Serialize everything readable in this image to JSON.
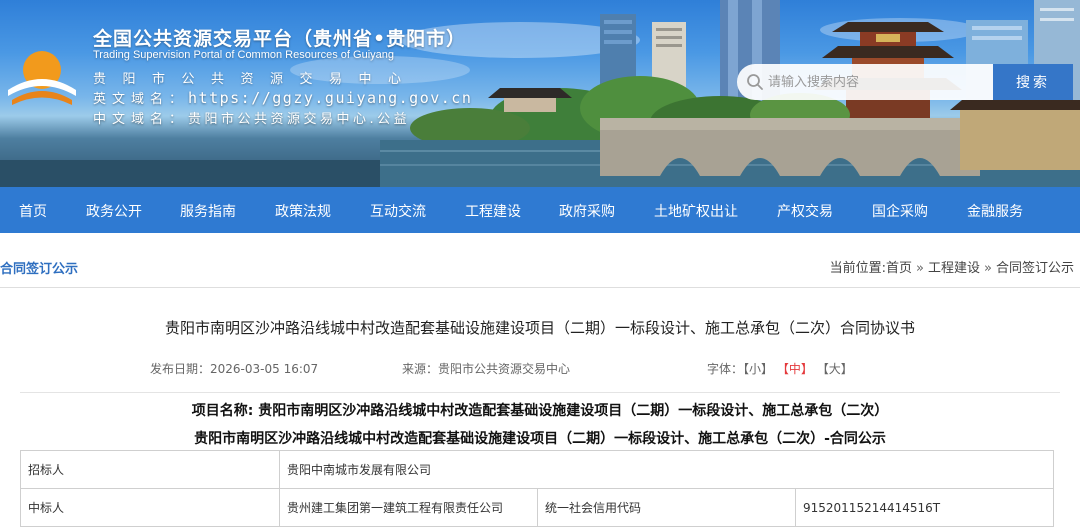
{
  "header": {
    "title": "全国公共资源交易平台（贵州省•贵阳市）",
    "subtitle": "Trading Supervision Portal of Common Resources of Guiyang",
    "org": "贵阳市公共资源交易中心",
    "en_domain_label": "英文域名：",
    "en_domain": "https://ggzy.guiyang.gov.cn",
    "cn_domain_label": "中文域名：",
    "cn_domain": "贵阳市公共资源交易中心.公益"
  },
  "search": {
    "placeholder": "请输入搜索内容",
    "button_label": "搜索"
  },
  "nav": {
    "items": [
      "首页",
      "政务公开",
      "服务指南",
      "政策法规",
      "互动交流",
      "工程建设",
      "政府采购",
      "土地矿权出让",
      "产权交易",
      "国企采购",
      "金融服务"
    ]
  },
  "breadcrumb": {
    "section": "合同签订公示",
    "prefix": "当前位置:",
    "items": [
      "首页",
      "工程建设",
      "合同签订公示"
    ],
    "separator": "»"
  },
  "article": {
    "title": "贵阳市南明区沙冲路沿线城中村改造配套基础设施建设项目（二期）一标段设计、施工总承包（二次）合同协议书",
    "date_label": "发布日期：",
    "date": "2026-03-05 16:07",
    "source_label": "来源：",
    "source": "贵阳市公共资源交易中心",
    "font_label": "字体：",
    "font_small": "【小】",
    "font_medium": "【中】",
    "font_large": "【大】",
    "project_name_label": "项目名称:",
    "project_name": "贵阳市南明区沙冲路沿线城中村改造配套基础设施建设项目（二期）一标段设计、施工总承包（二次）",
    "notice_title": "贵阳市南明区沙冲路沿线城中村改造配套基础设施建设项目（二期）一标段设计、施工总承包（二次）-合同公示"
  },
  "table": {
    "tenderer_label": "招标人",
    "tenderer_value": "贵阳中南城市发展有限公司",
    "winner_label": "中标人",
    "winner_value": "贵州建工集团第一建筑工程有限责任公司",
    "credit_code_label": "统一社会信用代码",
    "credit_code_value": "91520115214414516T"
  },
  "colors": {
    "nav_bg": "#2f7ad2",
    "search_button": "#3576c8",
    "font_active": "#e4393c",
    "breadcrumb_section": "#2f6fc0"
  }
}
